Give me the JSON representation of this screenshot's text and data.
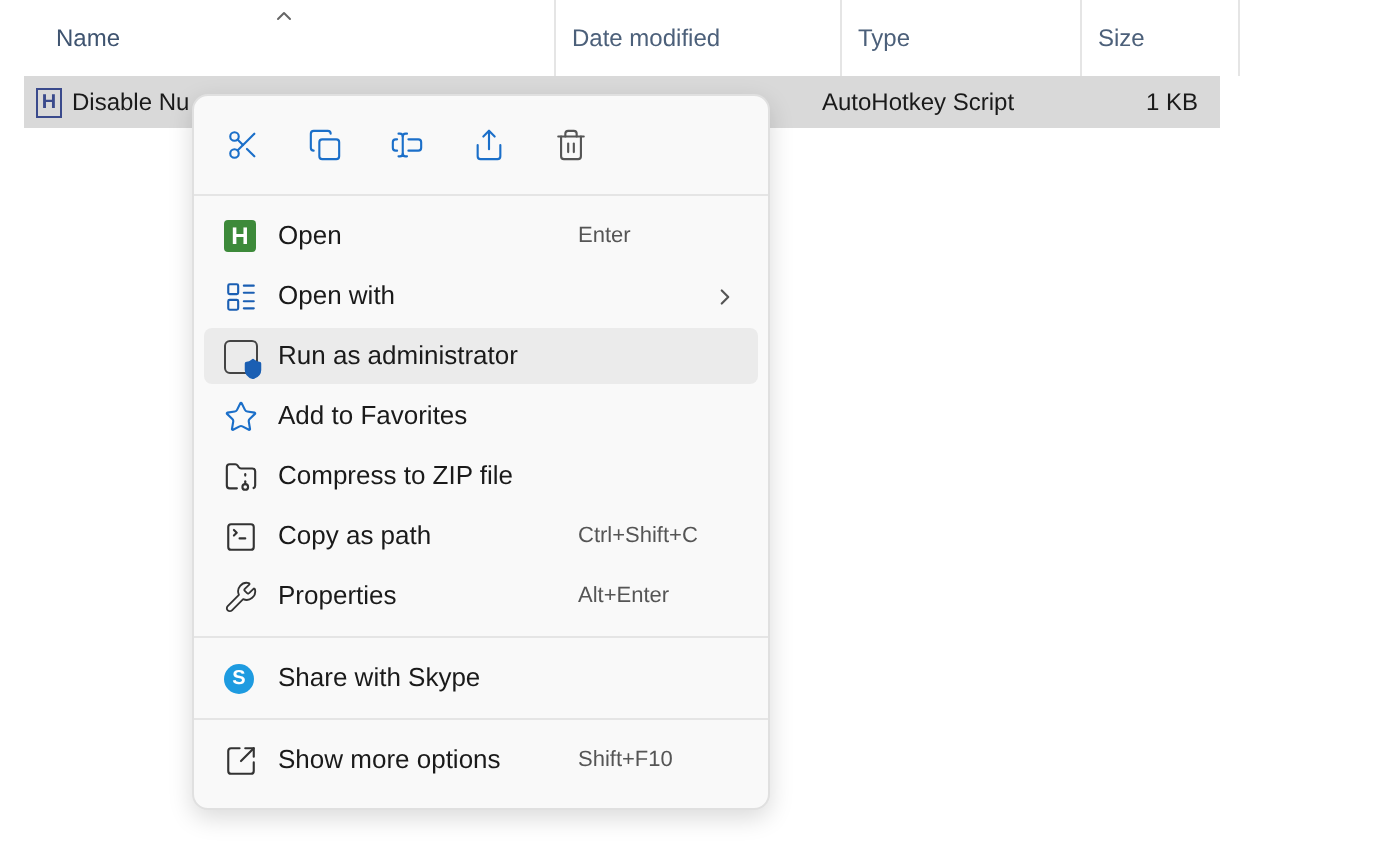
{
  "columns": [
    {
      "label": "Name",
      "sorted": true
    },
    {
      "label": "Date modified",
      "sorted": false
    },
    {
      "label": "Type",
      "sorted": false
    },
    {
      "label": "Size",
      "sorted": false
    }
  ],
  "file": {
    "icon_text": "H",
    "name": "Disable Nu",
    "type": "AutoHotkey Script",
    "size": "1 KB",
    "selected": true
  },
  "menu": {
    "groups": [
      [
        {
          "label": "Open",
          "shortcut": "Enter",
          "icon_text": "H",
          "submenu": false,
          "highlighted": false
        },
        {
          "label": "Open with",
          "submenu": true,
          "highlighted": false
        },
        {
          "label": "Run as administrator",
          "submenu": false,
          "highlighted": true
        },
        {
          "label": "Add to Favorites",
          "submenu": false,
          "highlighted": false
        },
        {
          "label": "Compress to ZIP file",
          "submenu": false,
          "highlighted": false
        },
        {
          "label": "Copy as path",
          "shortcut": "Ctrl+Shift+C",
          "submenu": false,
          "highlighted": false
        },
        {
          "label": "Properties",
          "shortcut": "Alt+Enter",
          "submenu": false,
          "highlighted": false
        }
      ],
      [
        {
          "label": "Share with Skype",
          "icon_text": "S",
          "submenu": false,
          "highlighted": false
        }
      ],
      [
        {
          "label": "Show more options",
          "shortcut": "Shift+F10",
          "submenu": false,
          "highlighted": false
        }
      ]
    ]
  }
}
